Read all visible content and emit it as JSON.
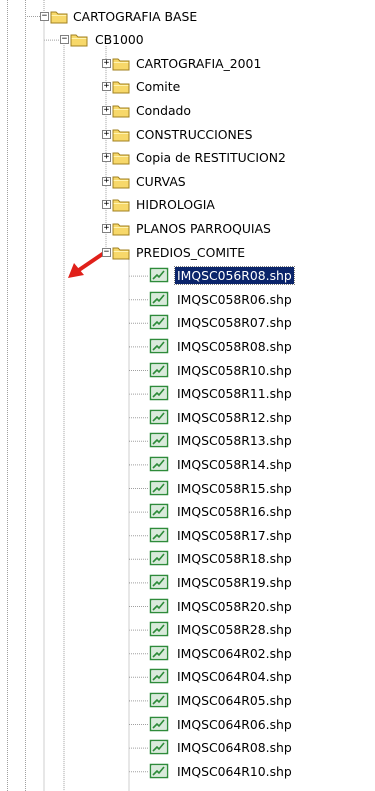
{
  "tree": {
    "root": {
      "label": "CARTOGRAFIA BASE",
      "expander": "−"
    },
    "cb1000": {
      "label": "CB1000",
      "expander": "−"
    },
    "folders": [
      {
        "label": "CARTOGRAFIA_2001",
        "expander": "+"
      },
      {
        "label": "Comite",
        "expander": "+"
      },
      {
        "label": "Condado",
        "expander": "+"
      },
      {
        "label": "CONSTRUCCIONES",
        "expander": "+"
      },
      {
        "label": "Copia de RESTITUCION2",
        "expander": "+"
      },
      {
        "label": "CURVAS",
        "expander": "+"
      },
      {
        "label": "HIDROLOGIA",
        "expander": "+"
      },
      {
        "label": "PLANOS PARROQUIAS",
        "expander": "+"
      },
      {
        "label": "PREDIOS_COMITE",
        "expander": "−"
      }
    ],
    "files": [
      {
        "label": "IMQSC056R08.shp",
        "selected": true
      },
      {
        "label": "IMQSC058R06.shp"
      },
      {
        "label": "IMQSC058R07.shp"
      },
      {
        "label": "IMQSC058R08.shp"
      },
      {
        "label": "IMQSC058R10.shp"
      },
      {
        "label": "IMQSC058R11.shp"
      },
      {
        "label": "IMQSC058R12.shp"
      },
      {
        "label": "IMQSC058R13.shp"
      },
      {
        "label": "IMQSC058R14.shp"
      },
      {
        "label": "IMQSC058R15.shp"
      },
      {
        "label": "IMQSC058R16.shp"
      },
      {
        "label": "IMQSC058R17.shp"
      },
      {
        "label": "IMQSC058R18.shp"
      },
      {
        "label": "IMQSC058R19.shp"
      },
      {
        "label": "IMQSC058R20.shp"
      },
      {
        "label": "IMQSC058R28.shp"
      },
      {
        "label": "IMQSC064R02.shp"
      },
      {
        "label": "IMQSC064R04.shp"
      },
      {
        "label": "IMQSC064R05.shp"
      },
      {
        "label": "IMQSC064R06.shp"
      },
      {
        "label": "IMQSC064R08.shp"
      },
      {
        "label": "IMQSC064R10.shp"
      }
    ]
  },
  "colors": {
    "folder": "#f7d86a",
    "folder_edge": "#a08020",
    "file_icon": "#2e8b3a",
    "selection": "#0a246a",
    "arrow": "#e0201a",
    "tree_lines": "#a0a0a0"
  },
  "icons": {
    "folder": "folder-icon",
    "file": "shapefile-icon",
    "annotation": "red-arrow-icon"
  }
}
